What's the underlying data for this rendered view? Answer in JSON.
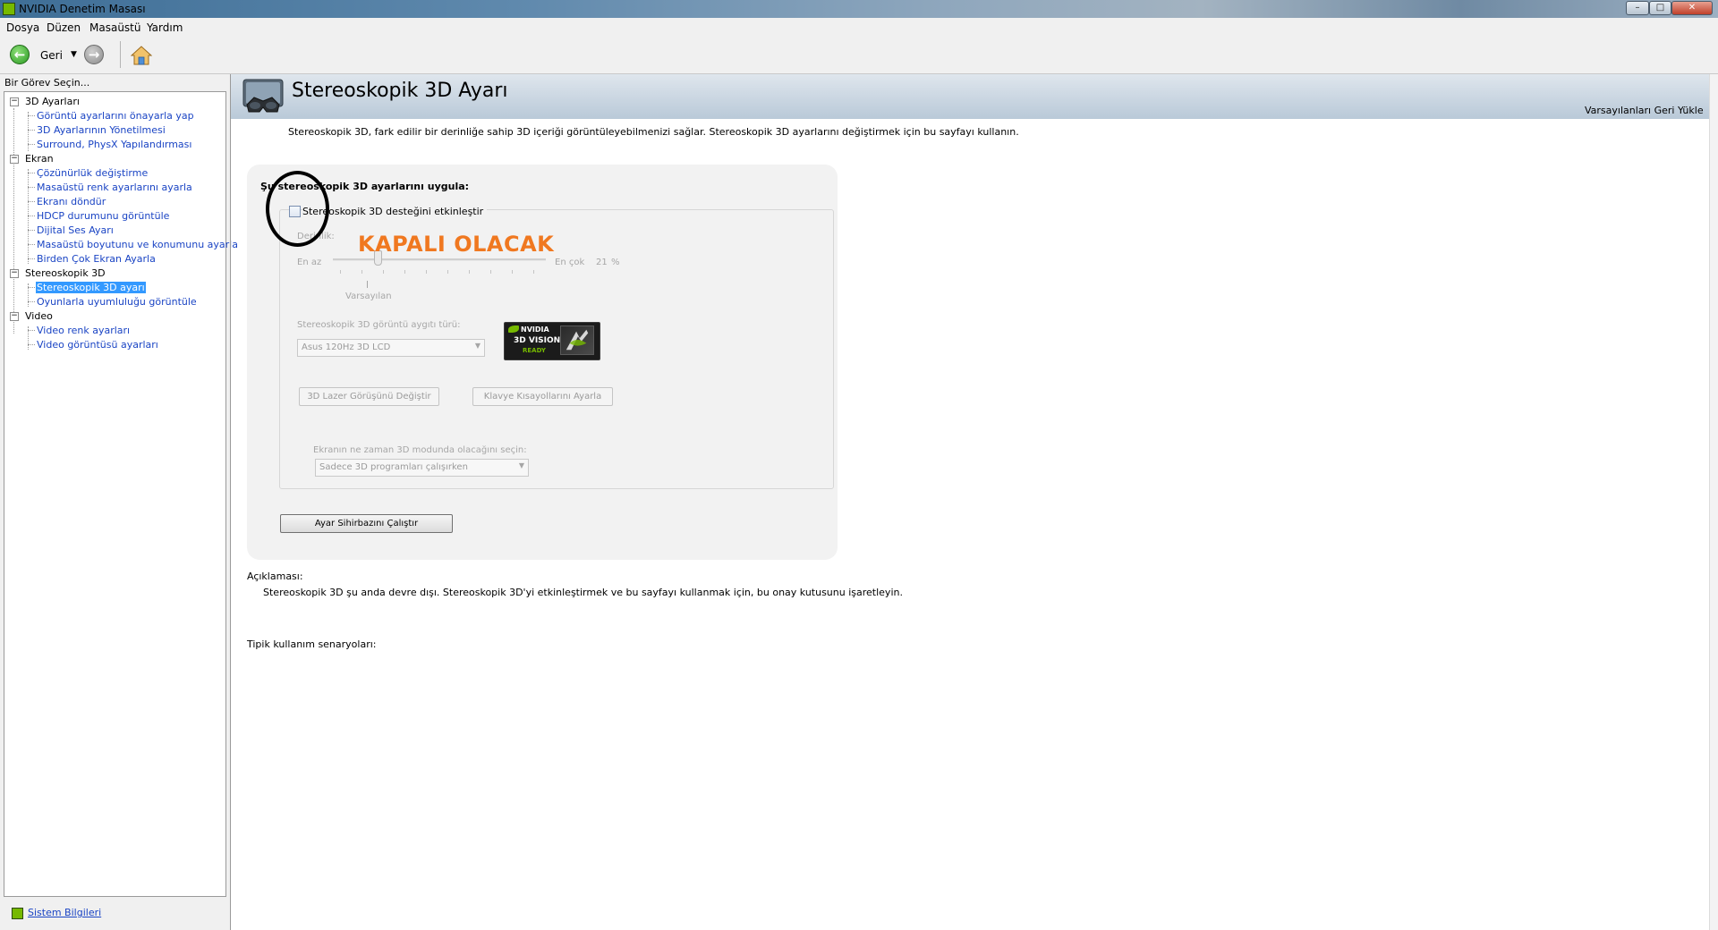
{
  "window": {
    "title": "NVIDIA Denetim Masası"
  },
  "menu": [
    "Dosya",
    "Düzen",
    "Masaüstü",
    "Yardım"
  ],
  "toolbar": {
    "back_label": "Geri"
  },
  "sidebar": {
    "header": "Bir Görev Seçin...",
    "categories": [
      {
        "label": "3D Ayarları",
        "items": [
          "Görüntü ayarlarını önayarla yap",
          "3D Ayarlarının Yönetilmesi",
          "Surround, PhysX Yapılandırması"
        ]
      },
      {
        "label": "Ekran",
        "items": [
          "Çözünürlük değiştirme",
          "Masaüstü renk ayarlarını ayarla",
          "Ekranı döndür",
          "HDCP durumunu görüntüle",
          "Dijital Ses Ayarı",
          "Masaüstü boyutunu ve konumunu ayarla",
          "Birden Çok Ekran Ayarla"
        ]
      },
      {
        "label": "Stereoskopik 3D",
        "items": [
          "Stereoskopik 3D ayarı",
          "Oyunlarla uyumluluğu görüntüle"
        ]
      },
      {
        "label": "Video",
        "items": [
          "Video renk ayarları",
          "Video görüntüsü ayarları"
        ]
      }
    ],
    "selected": "Stereoskopik 3D ayarı",
    "footer_link": "Sistem Bilgileri"
  },
  "page": {
    "title": "Stereoskopik 3D Ayarı",
    "restore_defaults": "Varsayılanları Geri Yükle",
    "intro": "Stereoskopik 3D, fark edilir bir derinliğe sahip 3D içeriği görüntüleyebilmenizi sağlar. Stereoskopik 3D ayarlarını değiştirmek için bu sayfayı kullanın.",
    "group_title": "Şu stereoskopik 3D ayarlarını uygula:",
    "enable_label": "Stereoskopik 3D desteğini etkinleştir",
    "enable_checked": false,
    "annotation": "KAPALI OLACAK",
    "depth": {
      "label": "Derinlik:",
      "min_label": "En az",
      "max_label": "En çok",
      "value": 21,
      "unit": "%",
      "default_label": "Varsayılan"
    },
    "device_type": {
      "label": "Stereoskopik 3D görüntü aygıtı türü:",
      "selected": "Asus 120Hz 3D LCD"
    },
    "badge": {
      "brand": "NVIDIA",
      "product": "3D VISION",
      "status": "READY"
    },
    "laser_button": "3D Lazer Görüşünü Değiştir",
    "keys_button": "Klavye Kısayollarını Ayarla",
    "mode": {
      "label": "Ekranın ne zaman 3D modunda olacağını seçin:",
      "selected": "Sadece 3D programları çalışırken"
    },
    "wizard_button": "Ayar Sihirbazını Çalıştır",
    "description_title": "Açıklaması:",
    "description_text": "Stereoskopik 3D şu anda devre dışı. Stereoskopik 3D'yi etkinleştirmek ve bu sayfayı kullanmak için, bu onay kutusunu işaretleyin.",
    "usage_title": "Tipik kullanım senaryoları:"
  },
  "colors": {
    "accent_green": "#76b900",
    "link": "#1a44c4",
    "selection": "#3399ff",
    "annotation": "#f07820"
  }
}
